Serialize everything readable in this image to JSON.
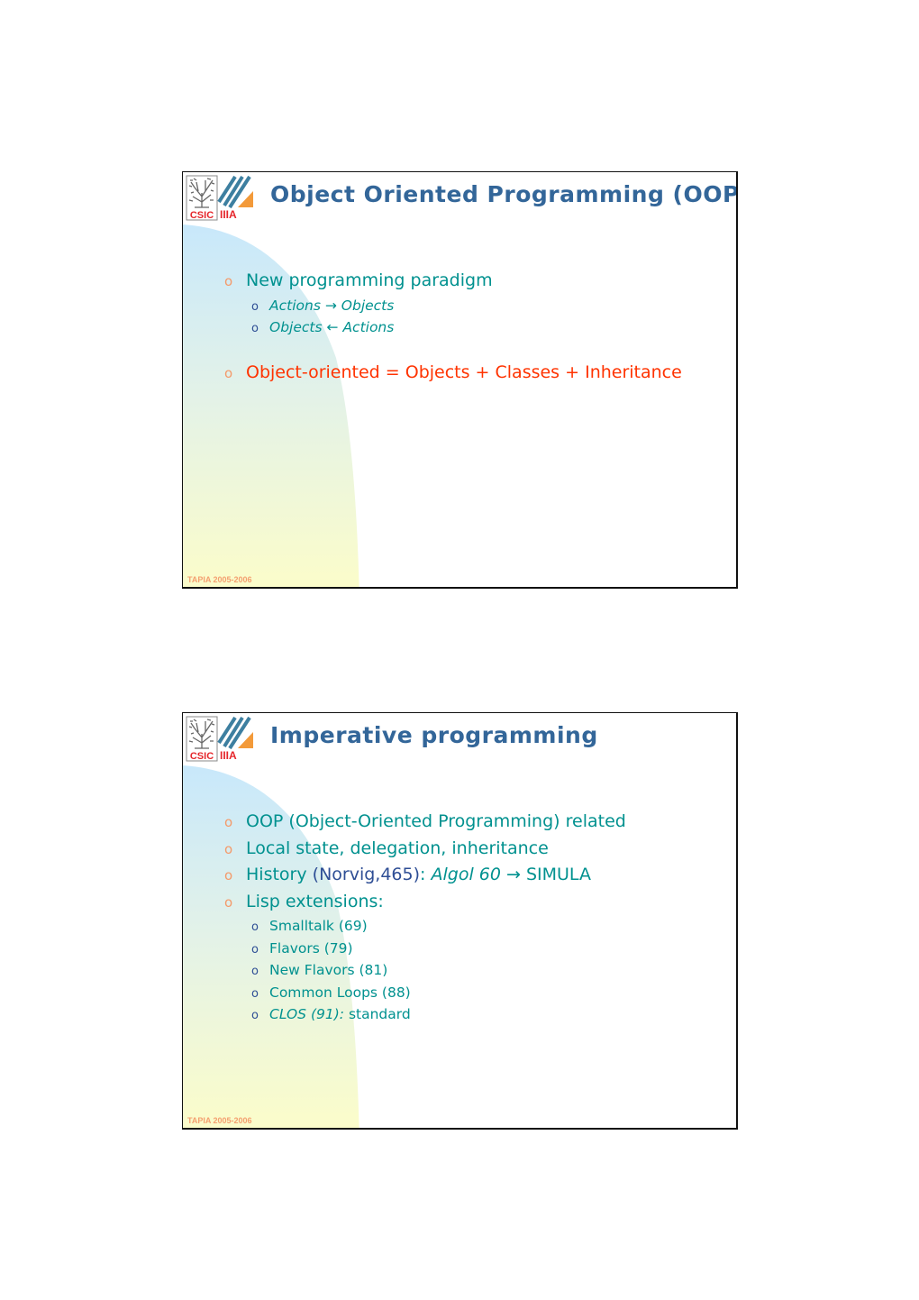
{
  "footer_text": "TAPIA 2005-2006",
  "logo": {
    "left_text": "CSIC",
    "right_text": "IIIA"
  },
  "colors": {
    "title": "#336699",
    "body_text": "#00918f",
    "highlight": "#ff3300",
    "bullet_level1": "#f49a6a",
    "bullet_level2": "#2e4e95",
    "footer": "#f4a070",
    "arc_top": "#c8e8fb",
    "arc_bottom": "#fdfdc8"
  },
  "slides": [
    {
      "title": "Object Oriented Programming (OOP)",
      "bullet_glyph": "o",
      "items": [
        {
          "text": "New programming paradigm",
          "sub": [
            {
              "a": "Actions",
              "arrow": "→",
              "b": "Objects"
            },
            {
              "a": "Objects",
              "arrow": "←",
              "b": "Actions"
            }
          ]
        },
        {
          "text": "Object-oriented = Objects + Classes + Inheritance"
        }
      ]
    },
    {
      "title": "Imperative programming",
      "bullet_glyph": "o",
      "items": [
        {
          "text": "OOP (Object-Oriented Programming) related"
        },
        {
          "text": "Local state, delegation, inheritance"
        },
        {
          "history_label": "History",
          "history_ref": "(Norvig,465)",
          "history_colon": ":",
          "history_from": "Algol 60",
          "history_arrow": "→",
          "history_to": "SIMULA"
        },
        {
          "text": "Lisp extensions:",
          "sub": [
            "Smalltalk (69)",
            "Flavors (79)",
            "New Flavors (81)",
            "Common Loops (88)",
            {
              "italic": "CLOS (91):",
              "rest": "standard"
            }
          ]
        }
      ]
    }
  ]
}
